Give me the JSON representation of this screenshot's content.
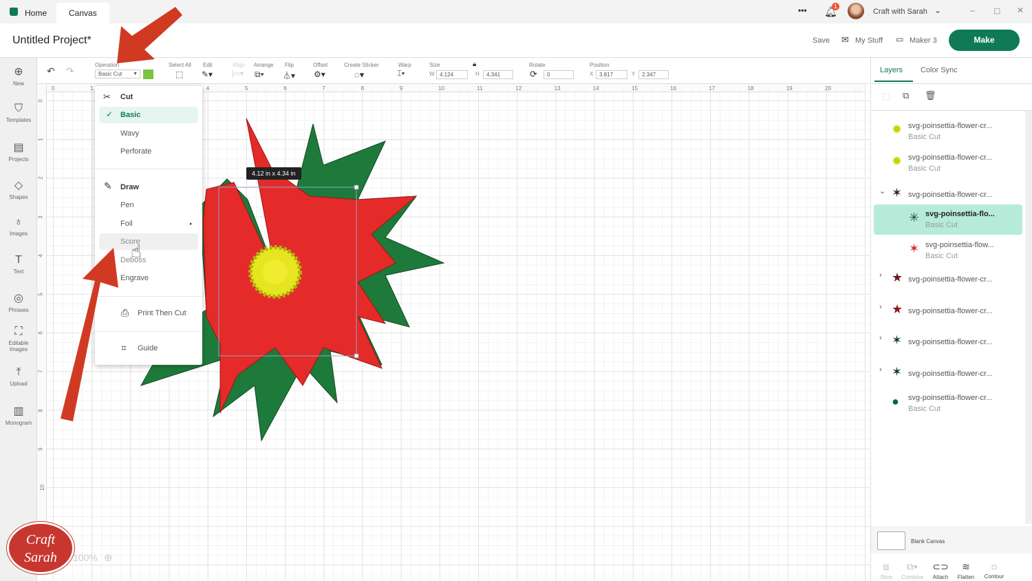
{
  "titlebar": {
    "tabs": [
      {
        "label": "Home"
      },
      {
        "label": "Canvas"
      }
    ],
    "more": "•••",
    "notifications": "1",
    "user": "Craft with Sarah"
  },
  "header": {
    "project_title": "Untitled Project*",
    "save": "Save",
    "my_stuff": "My Stuff",
    "machine": "Maker 3",
    "make": "Make"
  },
  "toolbar": {
    "operation_label": "Operation",
    "operation_value": "Basic Cut",
    "operation_color": "#7dc242",
    "select_all": "Select All",
    "edit": "Edit",
    "align": "Align",
    "arrange": "Arrange",
    "flip": "Flip",
    "offset": "Offset",
    "create_sticker": "Create Sticker",
    "warp": "Warp",
    "size_label": "Size",
    "w_label": "W",
    "w": "4.124",
    "h_label": "H",
    "h": "4.341",
    "rotate_label": "Rotate",
    "rotate": "0",
    "position_label": "Position",
    "x_label": "X",
    "x": "3.817",
    "y_label": "Y",
    "y": "2.347"
  },
  "sidebar": {
    "items": [
      {
        "label": "New",
        "icon": "plus-circle"
      },
      {
        "label": "Templates",
        "icon": "shirt"
      },
      {
        "label": "Projects",
        "icon": "clipboard"
      },
      {
        "label": "Shapes",
        "icon": "shapes"
      },
      {
        "label": "Images",
        "icon": "lightbulb"
      },
      {
        "label": "Text",
        "icon": "text-t"
      },
      {
        "label": "Phrases",
        "icon": "speech"
      },
      {
        "label": "Editable Images",
        "icon": "edit-image"
      },
      {
        "label": "Upload",
        "icon": "upload"
      },
      {
        "label": "Monogram",
        "icon": "monogram"
      }
    ]
  },
  "rulers": {
    "h": [
      "0",
      "1",
      "2",
      "3",
      "4",
      "5",
      "6",
      "7",
      "8",
      "9",
      "10",
      "11",
      "12",
      "13",
      "14",
      "15",
      "16",
      "17",
      "18",
      "19",
      "20"
    ],
    "v": [
      "0",
      "1",
      "2",
      "3",
      "4",
      "5",
      "6",
      "7",
      "8",
      "9",
      "10"
    ]
  },
  "menu": {
    "cut": "Cut",
    "basic": "Basic",
    "wavy": "Wavy",
    "perforate": "Perforate",
    "draw": "Draw",
    "pen": "Pen",
    "foil": "Foil",
    "score": "Score",
    "deboss": "Deboss",
    "engrave": "Engrave",
    "print_then_cut": "Print Then Cut",
    "guide": "Guide"
  },
  "selection": {
    "dimensions": "4.12  in x 4.34  in"
  },
  "zoom": "100%",
  "logo_text": "Craft with Sarah",
  "panel": {
    "tabs": [
      {
        "label": "Layers"
      },
      {
        "label": "Color Sync"
      }
    ],
    "layers": [
      {
        "name": "svg-poinsettia-flower-cr...",
        "op": "Basic Cut",
        "color": "#c8d400",
        "icon": "✹",
        "chevron": ""
      },
      {
        "name": "svg-poinsettia-flower-cr...",
        "op": "Basic Cut",
        "color": "#c8d400",
        "icon": "✹",
        "chevron": ""
      },
      {
        "name": "svg-poinsettia-flower-cr...",
        "op": "",
        "color": "#3a1a1a",
        "icon": "✶",
        "chevron": "⌄"
      },
      {
        "name": "svg-poinsettia-flo...",
        "op": "Basic Cut",
        "color": "#1f4f3a",
        "icon": "✳",
        "chevron": ""
      },
      {
        "name": "svg-poinsettia-flow...",
        "op": "Basic Cut",
        "color": "#d42a2a",
        "icon": "✶",
        "chevron": ""
      },
      {
        "name": "svg-poinsettia-flower-cr...",
        "op": "",
        "color": "#6e1a1a",
        "icon": "★",
        "chevron": "›"
      },
      {
        "name": "svg-poinsettia-flower-cr...",
        "op": "",
        "color": "#8a1a1a",
        "icon": "★",
        "chevron": "›"
      },
      {
        "name": "svg-poinsettia-flower-cr...",
        "op": "",
        "color": "#0f3a25",
        "icon": "✶",
        "chevron": "›"
      },
      {
        "name": "svg-poinsettia-flower-cr...",
        "op": "",
        "color": "#0f3a25",
        "icon": "✶",
        "chevron": "›"
      },
      {
        "name": "svg-poinsettia-flower-cr...",
        "op": "Basic Cut",
        "color": "#0f6a35",
        "icon": "●",
        "chevron": ""
      }
    ],
    "blank_canvas": "Blank Canvas",
    "actions": [
      {
        "label": "Slice",
        "icon": "slice"
      },
      {
        "label": "Combine",
        "icon": "combine"
      },
      {
        "label": "Attach",
        "icon": "paperclip"
      },
      {
        "label": "Flatten",
        "icon": "flatten"
      },
      {
        "label": "Contour",
        "icon": "contour"
      }
    ]
  },
  "colors": {
    "accent": "#0f7a55",
    "selected_layer": "#b7ebd9",
    "arrow": "#d03a22"
  }
}
